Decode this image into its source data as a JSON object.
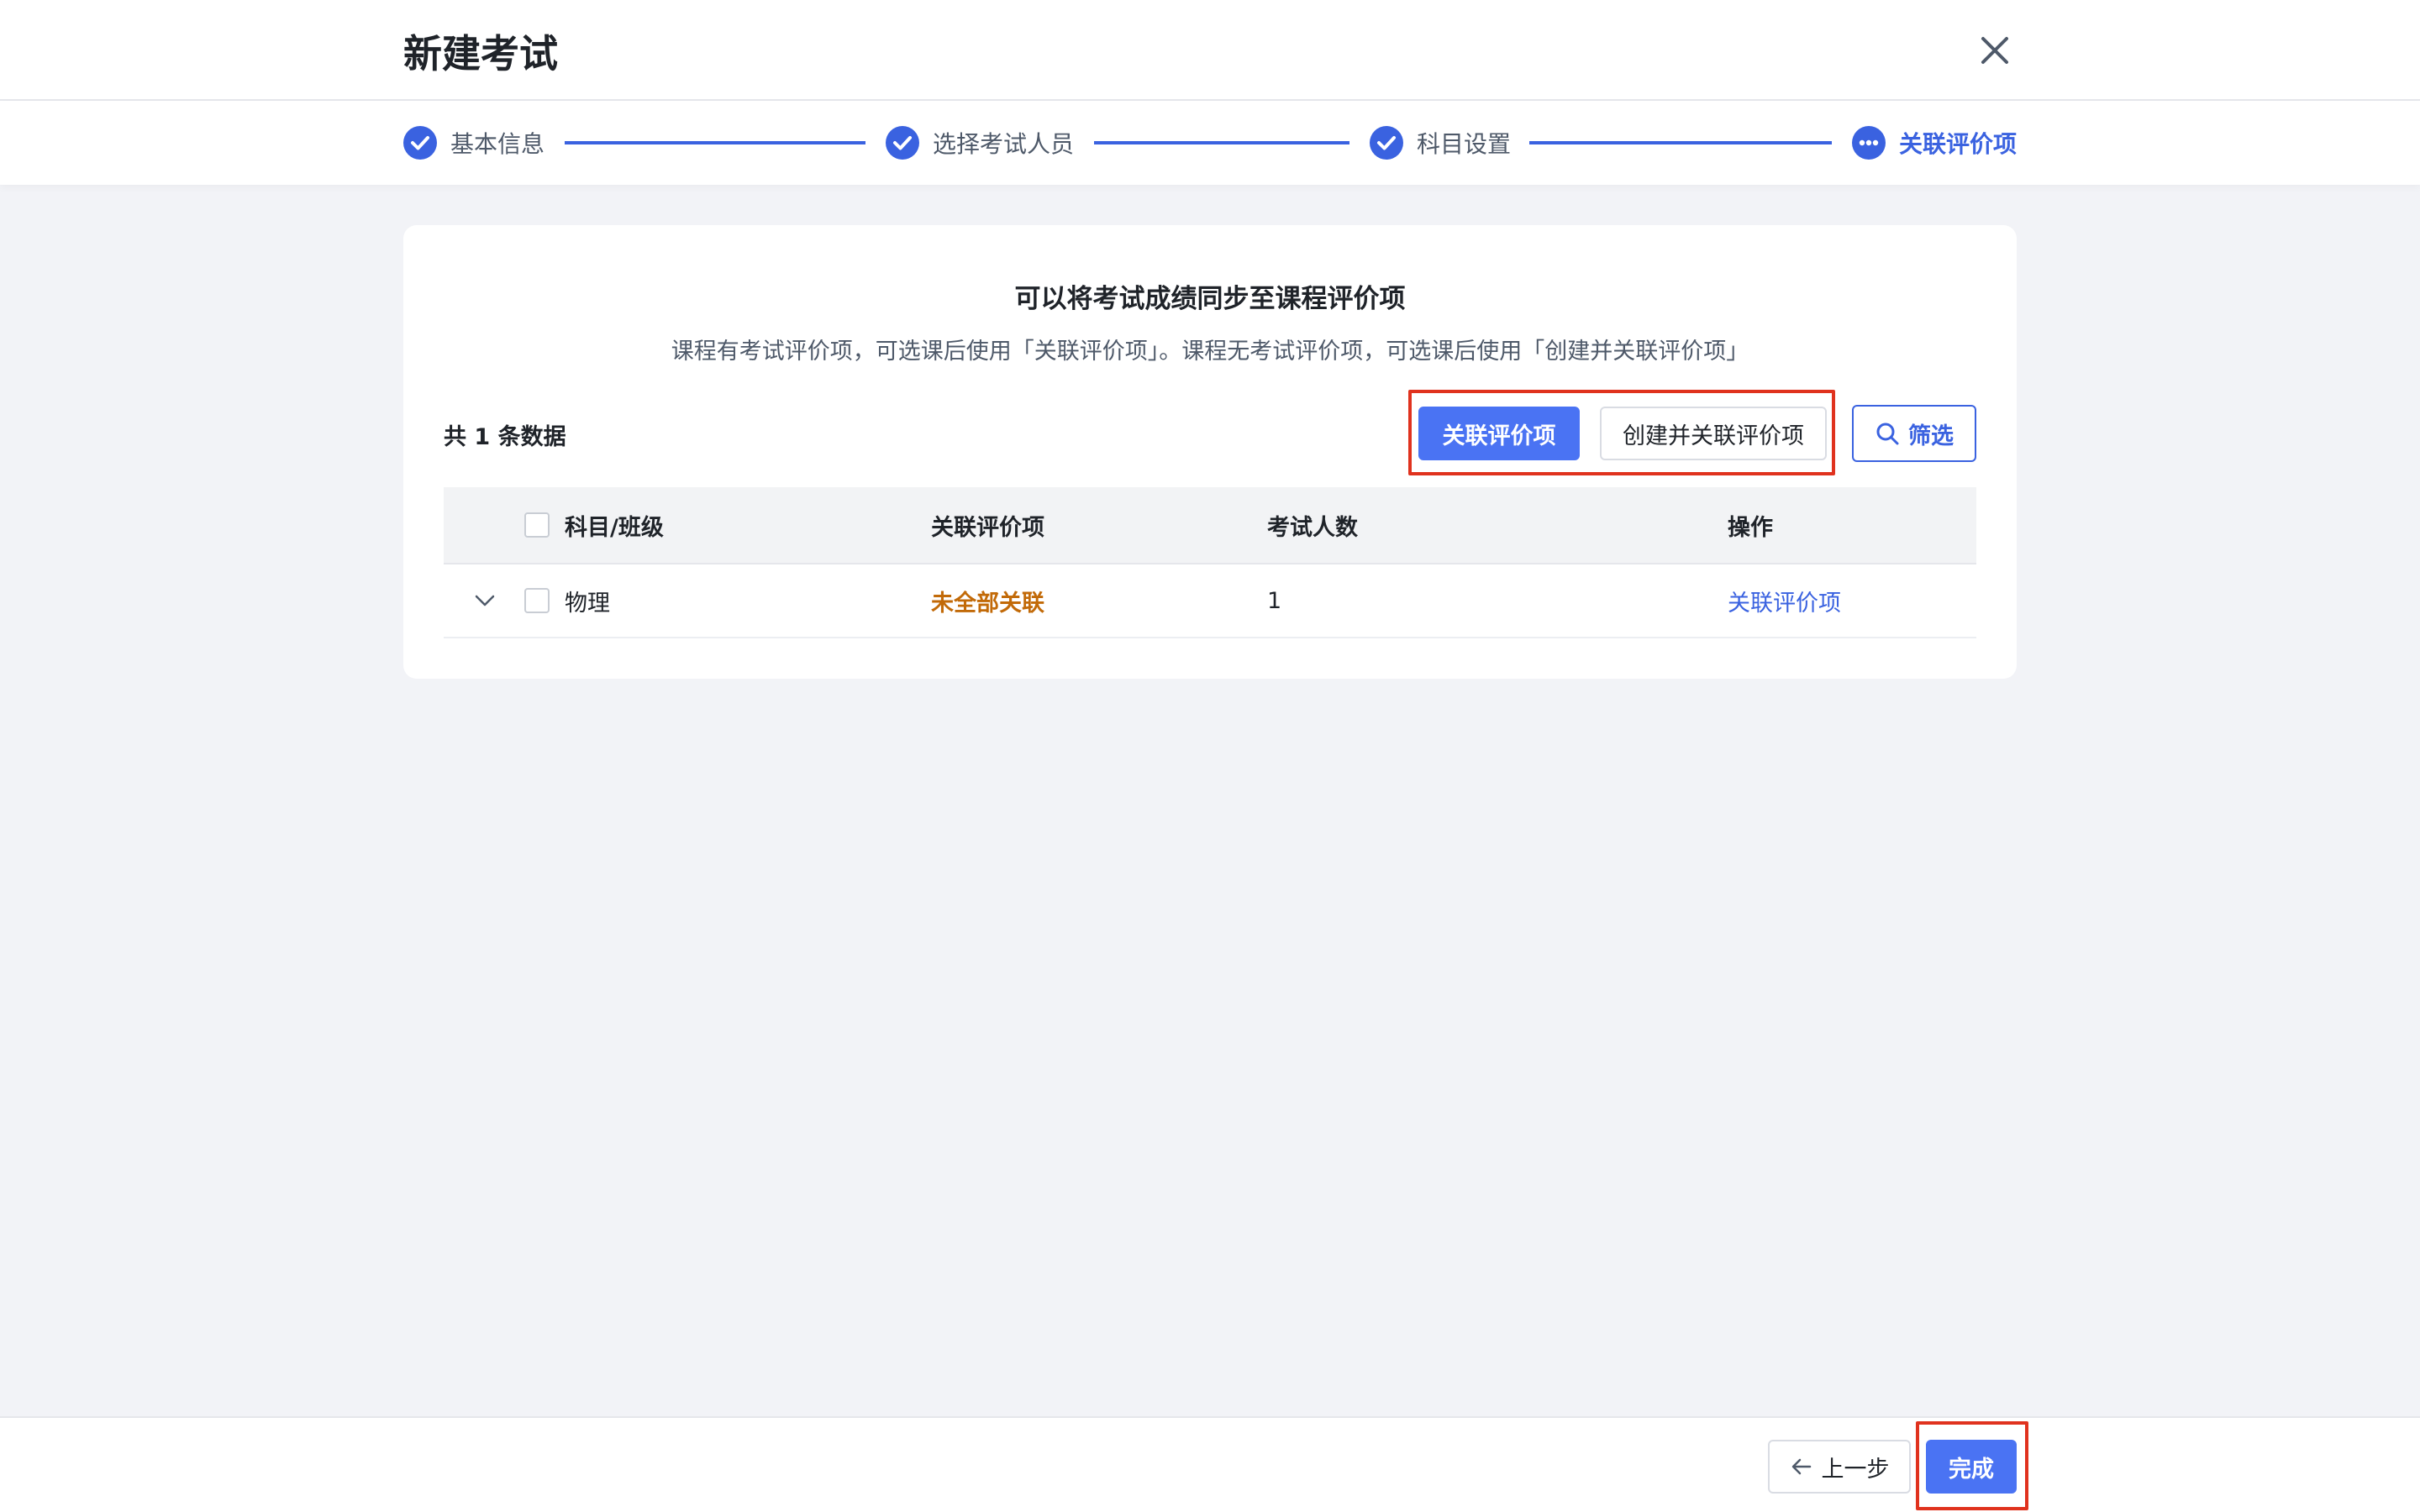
{
  "dialog": {
    "title": "新建考试",
    "close_icon": "close-icon"
  },
  "steps": [
    {
      "label": "基本信息",
      "status": "done",
      "icon": "check-circle-icon"
    },
    {
      "label": "选择考试人员",
      "status": "done",
      "icon": "check-circle-icon"
    },
    {
      "label": "科目设置",
      "status": "done",
      "icon": "check-circle-icon"
    },
    {
      "label": "关联评价项",
      "status": "current",
      "icon": "more-circle-icon"
    }
  ],
  "card": {
    "title": "可以将考试成绩同步至课程评价项",
    "subtitle": "课程有考试评价项，可选课后使用「关联评价项」。课程无考试评价项，可选课后使用「创建并关联评价项」"
  },
  "toolbar": {
    "count_text": "共 1 条数据",
    "link_button": "关联评价项",
    "create_link_button": "创建并关联评价项",
    "filter_button": "筛选",
    "filter_icon": "search-icon"
  },
  "table": {
    "columns": [
      "科目/班级",
      "关联评价项",
      "考试人数",
      "操作"
    ],
    "rows": [
      {
        "subject": "物理",
        "link_status": "未全部关联",
        "count": "1",
        "action": "关联评价项"
      }
    ]
  },
  "footer": {
    "prev_button": "上一步",
    "finish_button": "完成"
  },
  "colors": {
    "primary": "#4a73f3",
    "link": "#3a62e0",
    "warning": "#c26a08",
    "highlight": "#e0321e",
    "background": "#f2f3f7"
  }
}
